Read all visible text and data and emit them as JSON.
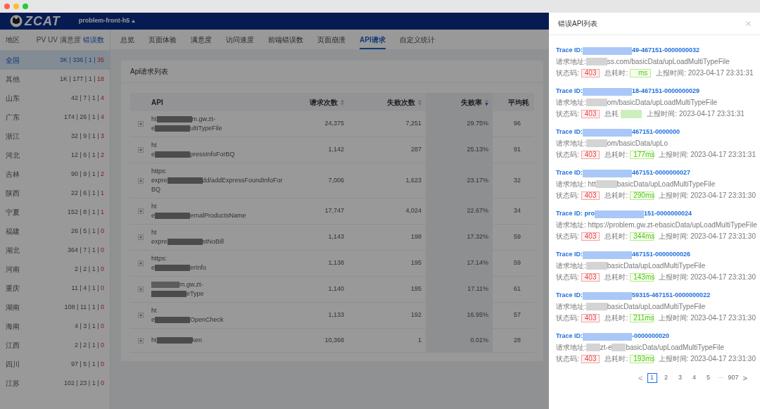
{
  "header": {
    "logo": "ZCAT",
    "project": "problem-front-h5"
  },
  "sidebar": {
    "title": "地区",
    "metrics": [
      {
        "label": "PV",
        "selected": false
      },
      {
        "label": "UV",
        "selected": false
      },
      {
        "label": "满意度",
        "selected": false
      },
      {
        "label": "错误数",
        "selected": true
      }
    ],
    "regions": [
      {
        "name": "全国",
        "stats": "3K | 336 | 1 |",
        "errors": "35",
        "selected": true
      },
      {
        "name": "其他",
        "stats": "1K | 177 | 1 |",
        "errors": "18",
        "selected": false
      },
      {
        "name": "山东",
        "stats": "42 | 7 | 1 |",
        "errors": "4",
        "selected": false
      },
      {
        "name": "广东",
        "stats": "174 | 26 | 1 |",
        "errors": "4",
        "selected": false
      },
      {
        "name": "浙江",
        "stats": "32 | 9 | 1 |",
        "errors": "3",
        "selected": false
      },
      {
        "name": "河北",
        "stats": "12 | 6 | 1 |",
        "errors": "2",
        "selected": false
      },
      {
        "name": "吉林",
        "stats": "90 | 9 | 1 |",
        "errors": "2",
        "selected": false
      },
      {
        "name": "陕西",
        "stats": "22 | 6 | 1 |",
        "errors": "1",
        "selected": false
      },
      {
        "name": "宁夏",
        "stats": "152 | 8 | 1 |",
        "errors": "1",
        "selected": false
      },
      {
        "name": "福建",
        "stats": "26 | 5 | 1 |",
        "errors": "0",
        "selected": false
      },
      {
        "name": "湖北",
        "stats": "364 | 7 | 1 |",
        "errors": "0",
        "selected": false
      },
      {
        "name": "河南",
        "stats": "2 | 2 | 1 |",
        "errors": "0",
        "selected": false
      },
      {
        "name": "重庆",
        "stats": "11 | 4 | 1 |",
        "errors": "0",
        "selected": false
      },
      {
        "name": "湖南",
        "stats": "108 | 11 | 1 |",
        "errors": "0",
        "selected": false
      },
      {
        "name": "海南",
        "stats": "4 | 3 | 1 |",
        "errors": "0",
        "selected": false
      },
      {
        "name": "江西",
        "stats": "2 | 2 | 1 |",
        "errors": "0",
        "selected": false
      },
      {
        "name": "四川",
        "stats": "97 | 5 | 1 |",
        "errors": "0",
        "selected": false
      },
      {
        "name": "江苏",
        "stats": "102 | 23 | 1 |",
        "errors": "0",
        "selected": false
      }
    ]
  },
  "tabs": [
    {
      "label": "总览",
      "selected": false
    },
    {
      "label": "页面体验",
      "selected": false
    },
    {
      "label": "满意度",
      "selected": false
    },
    {
      "label": "访问速度",
      "selected": false
    },
    {
      "label": "前端错误数",
      "selected": false
    },
    {
      "label": "页面崩溃",
      "selected": false
    },
    {
      "label": "API请求",
      "selected": true
    },
    {
      "label": "自定义统计",
      "selected": false
    }
  ],
  "card": {
    "title": "Api请求列表",
    "columns": [
      {
        "label": "API",
        "sortable": false,
        "sorted_descending": false
      },
      {
        "label": "请求次数",
        "sortable": true,
        "sorted_descending": false
      },
      {
        "label": "失败次数",
        "sortable": true,
        "sorted_descending": false
      },
      {
        "label": "失败率",
        "sortable": true,
        "sorted_descending": true
      },
      {
        "label": "平均耗",
        "sortable": false,
        "sorted_descending": false
      }
    ],
    "rows": [
      {
        "api": [
          [
            "ht",
            "m.gw.zt-"
          ],
          [
            "e",
            "ultiTypeFile"
          ]
        ],
        "masked_start": false,
        "requests": "24,375",
        "failures": "7,251",
        "rate": "29.75%",
        "column_5": "96"
      },
      {
        "api": [
          [
            "ht"
          ],
          [
            "e",
            "pressInfoForBQ"
          ]
        ],
        "masked_start": false,
        "requests": "1,142",
        "failures": "287",
        "rate": "25.13%",
        "column_5": "91"
      },
      {
        "api": [
          [
            "https:"
          ],
          [
            "expre",
            "dd/addExpressFoundInfoFor"
          ],
          [
            "BQ"
          ]
        ],
        "masked_start": false,
        "requests": "7,006",
        "failures": "1,623",
        "rate": "23.17%",
        "column_5": "32"
      },
      {
        "api": [
          [
            "ht"
          ],
          [
            "e",
            "ernalProductsName"
          ]
        ],
        "masked_start": false,
        "requests": "17,747",
        "failures": "4,024",
        "rate": "22.67%",
        "column_5": "34"
      },
      {
        "api": [
          [
            "ht"
          ],
          [
            "expre",
            "stNoBill"
          ]
        ],
        "masked_start": false,
        "requests": "1,143",
        "failures": "198",
        "rate": "17.32%",
        "column_5": "59"
      },
      {
        "api": [
          [
            "https:"
          ],
          [
            "e",
            "erInfo"
          ]
        ],
        "masked_start": false,
        "requests": "1,138",
        "failures": "195",
        "rate": "17.14%",
        "column_5": "59"
      },
      {
        "api": [
          [
            "m.gw.zt-"
          ],
          [
            "eType"
          ]
        ],
        "masked_start": true,
        "requests": "1,140",
        "failures": "195",
        "rate": "17.11%",
        "column_5": "61"
      },
      {
        "api": [
          [
            "ht"
          ],
          [
            "e",
            "OpenCheck"
          ]
        ],
        "masked_start": false,
        "requests": "1,133",
        "failures": "192",
        "rate": "16.95%",
        "column_5": "57"
      },
      {
        "api": [
          [
            "ht",
            "ken"
          ]
        ],
        "masked_start": false,
        "requests": "10,368",
        "failures": "1",
        "rate": "0.01%",
        "column_5": "28"
      }
    ]
  },
  "drawer": {
    "title": "错误API列表",
    "entries": [
      {
        "trace": [
          "Trace ID:",
          "49-467151-0000000032"
        ],
        "url": [
          "请求地址:",
          "ss.com/basicData/upLoadMultiTypeFile"
        ],
        "status_label": "状态码:",
        "status": "403",
        "duration_label": "总耗时:",
        "duration": "ms",
        "time": "上报时间: 2023-04-17 23:31:31"
      },
      {
        "trace": [
          "Trace ID:",
          "18-467151-0000000029"
        ],
        "url": [
          "请求地址:",
          "om/basicData/upLoadMultiTypeFile"
        ],
        "status_label": "状态码:",
        "status": "403",
        "duration_label": "总耗",
        "time": "上报时间: 2023-04-17 23:31:31"
      },
      {
        "trace": [
          "Trace ID:",
          "467151-0000000"
        ],
        "url": [
          "请求地址:",
          "om/basicData/upLo"
        ],
        "status_label": "状态码:",
        "status": "403",
        "duration_label": "总耗时:",
        "duration": "177ms",
        "time": "上报时间: 2023-04-17 23:31:31"
      },
      {
        "trace": [
          "Trace ID:",
          "467151-0000000027"
        ],
        "url": [
          "请求地址: htt",
          "basicData/upLoadMultiTypeFile"
        ],
        "status_label": "状态码:",
        "status": "403",
        "duration_label": "总耗时:",
        "duration": "290ms",
        "time": "上报时间: 2023-04-17 23:31:30"
      },
      {
        "trace": [
          "Trace ID: pro",
          "151-0000000024"
        ],
        "url": [
          "请求地址: https://problem.gw.zt-e",
          "basicData/upLoadMultiTypeFile"
        ],
        "status_label": "状态码:",
        "status": "403",
        "duration_label": "总耗时:",
        "duration": "344ms",
        "time": "上报时间: 2023-04-17 23:31:30"
      },
      {
        "trace": [
          "Trace ID:",
          "467151-0000000026"
        ],
        "url": [
          "请求地址:",
          "basicData/upLoadMultiTypeFile"
        ],
        "status_label": "状态码:",
        "status": "403",
        "duration_label": "总耗时:",
        "duration": "143ms",
        "time": "上报时间: 2023-04-17 23:31:30"
      },
      {
        "trace": [
          "Trace ID:",
          "59315-467151-0000000022"
        ],
        "url": [
          "请求地址:",
          "basicData/upLoadMultiTypeFile"
        ],
        "status_label": "状态码:",
        "status": "403",
        "duration_label": "总耗时:",
        "duration": "211ms",
        "time": "上报时间: 2023-04-17 23:31:30"
      },
      {
        "trace": [
          "Trace ID:",
          "-0000000020"
        ],
        "url": [
          "请求地址:",
          "zt-e",
          "basicData/upLoadMultiTypeFile"
        ],
        "status_label": "状态码:",
        "status": "403",
        "duration_label": "总耗时:",
        "duration": "193ms",
        "time": "上报时间: 2023-04-17 23:31:30"
      }
    ],
    "pagination": {
      "prev": "<",
      "pages": [
        {
          "label": "1",
          "selected": true
        },
        {
          "label": "2",
          "selected": false
        },
        {
          "label": "3",
          "selected": false
        },
        {
          "label": "4",
          "selected": false
        },
        {
          "label": "5",
          "selected": false
        }
      ],
      "ellipsis": "···",
      "last": "907",
      "next": ">"
    }
  }
}
